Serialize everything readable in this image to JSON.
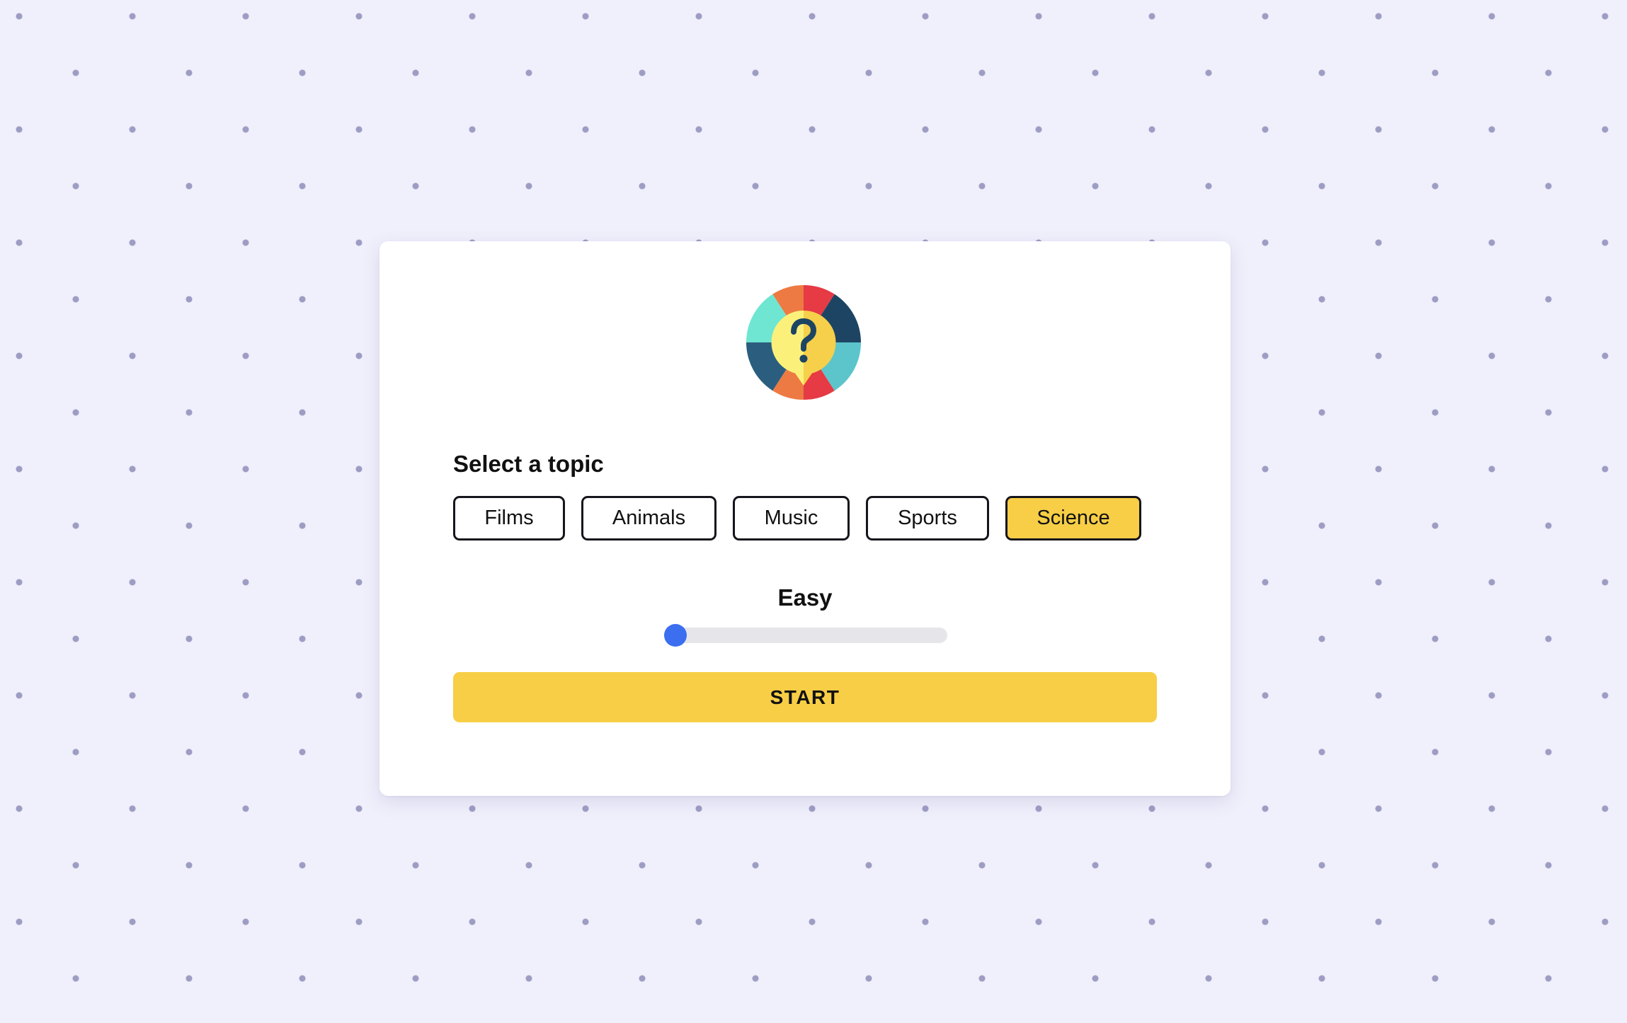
{
  "quiz": {
    "logo_icon": "quiz-wheel-question-icon",
    "section_title": "Select a topic",
    "topics": [
      {
        "label": "Films",
        "selected": false
      },
      {
        "label": "Animals",
        "selected": false
      },
      {
        "label": "Music",
        "selected": false
      },
      {
        "label": "Sports",
        "selected": false
      },
      {
        "label": "Science",
        "selected": true
      }
    ],
    "difficulty": {
      "label": "Easy",
      "level_fraction": 0
    },
    "start_label": "START"
  },
  "colors": {
    "background": "#f0f0fc",
    "accent_yellow": "#f7ce46",
    "slider_thumb": "#3b6ff0",
    "slider_track": "#e6e6ea"
  }
}
